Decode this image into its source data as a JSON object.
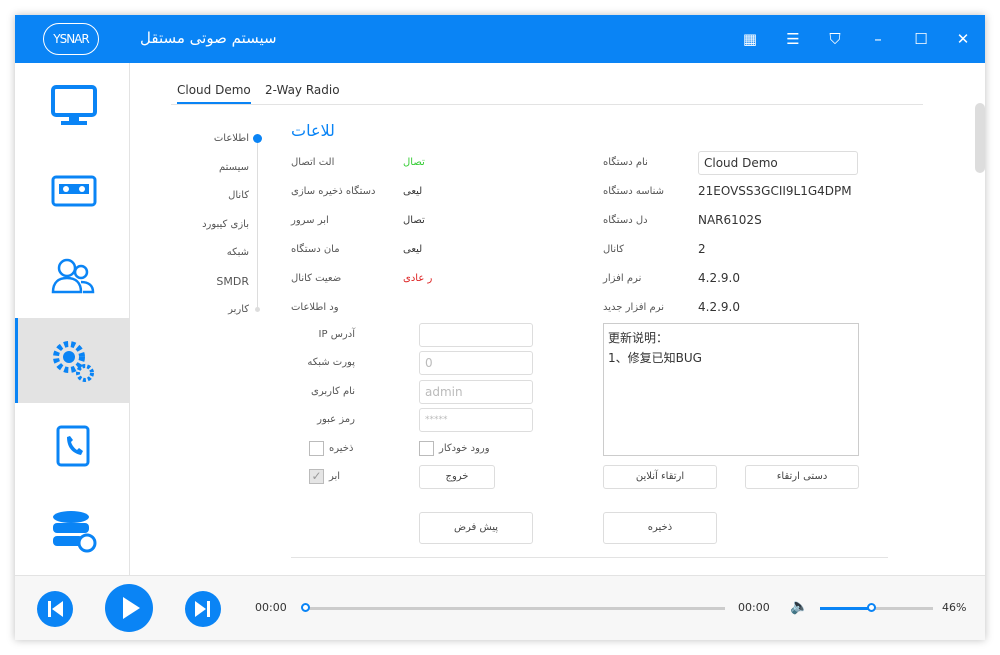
{
  "app": {
    "logo": "YSNAR",
    "title": "سیستم صوتی مستقل",
    "accent": "#0a84f5"
  },
  "titlebar_icons": [
    "grid-icon",
    "list-icon",
    "skin-icon",
    "minimize-icon",
    "maximize-icon",
    "close-icon"
  ],
  "sidebar": {
    "items": [
      {
        "icon": "monitor-icon"
      },
      {
        "icon": "recorder-icon"
      },
      {
        "icon": "users-icon"
      },
      {
        "icon": "settings-icon",
        "active": true
      },
      {
        "icon": "phonebook-icon"
      },
      {
        "icon": "database-icon"
      }
    ]
  },
  "tabs": [
    {
      "label": "Cloud Demo",
      "active": true
    },
    {
      "label": "2-Way Radio"
    }
  ],
  "nav": [
    "اطلاعات",
    "سیستم",
    "کانال",
    "بازی کیبورد",
    "شبکه",
    "SMDR",
    "کاربر"
  ],
  "section_title": "للاعات",
  "left_rows": [
    {
      "label": "الت اتصال",
      "value": "تصال",
      "color": "#33cc33"
    },
    {
      "label": "دستگاه ذخیره سازی",
      "value": "لیعی",
      "color": "#333333"
    },
    {
      "label": "ابر سرور",
      "value": "تصال",
      "color": "#333333"
    },
    {
      "label": "مان دستگاه",
      "value": "لیعی",
      "color": "#333333"
    },
    {
      "label": "ضعیت کانال",
      "value": "ر عادی",
      "color": "#dd2222"
    },
    {
      "label": "ود اطلاعات",
      "value": ""
    }
  ],
  "right_rows": [
    {
      "label": "نام دستگاه",
      "value": "Cloud Demo"
    },
    {
      "label": "شناسه دستگاه",
      "value": "21EOVSS3GCII9L1G4DPM"
    },
    {
      "label": "دل دستگاه",
      "value": "NAR6102S"
    },
    {
      "label": "کانال",
      "value": "2"
    },
    {
      "label": "نرم افزار",
      "value": "4.2.9.0"
    },
    {
      "label": "نرم افزار جدید",
      "value": "4.2.9.0"
    }
  ],
  "form": {
    "ip_label": "IP آدرس",
    "ip_value": "",
    "port_label": "پورت شبکه",
    "port_value": "0",
    "user_label": "نام کاربری",
    "user_value": "admin",
    "pass_label": "رمز عبور",
    "pass_value": "*****",
    "save_cb_label": "ذخیره",
    "save_cb_checked": false,
    "autologin_label": "ورود خودکار",
    "autologin_checked": false,
    "cloud_cb_label": "ابر",
    "cloud_cb_checked": true,
    "logout_button": "خروج",
    "default_button": "پیش فرض"
  },
  "update": {
    "notes_title": "更新说明：",
    "notes_line": "1、修复已知BUG",
    "online_button": "ارتقاء آنلاین",
    "manual_button": "دستی ارتقاء",
    "save_button": "ذخیره"
  },
  "player": {
    "current": "00:00",
    "total": "00:00",
    "progress": 0,
    "volume_percent": "46%",
    "volume": 46
  }
}
